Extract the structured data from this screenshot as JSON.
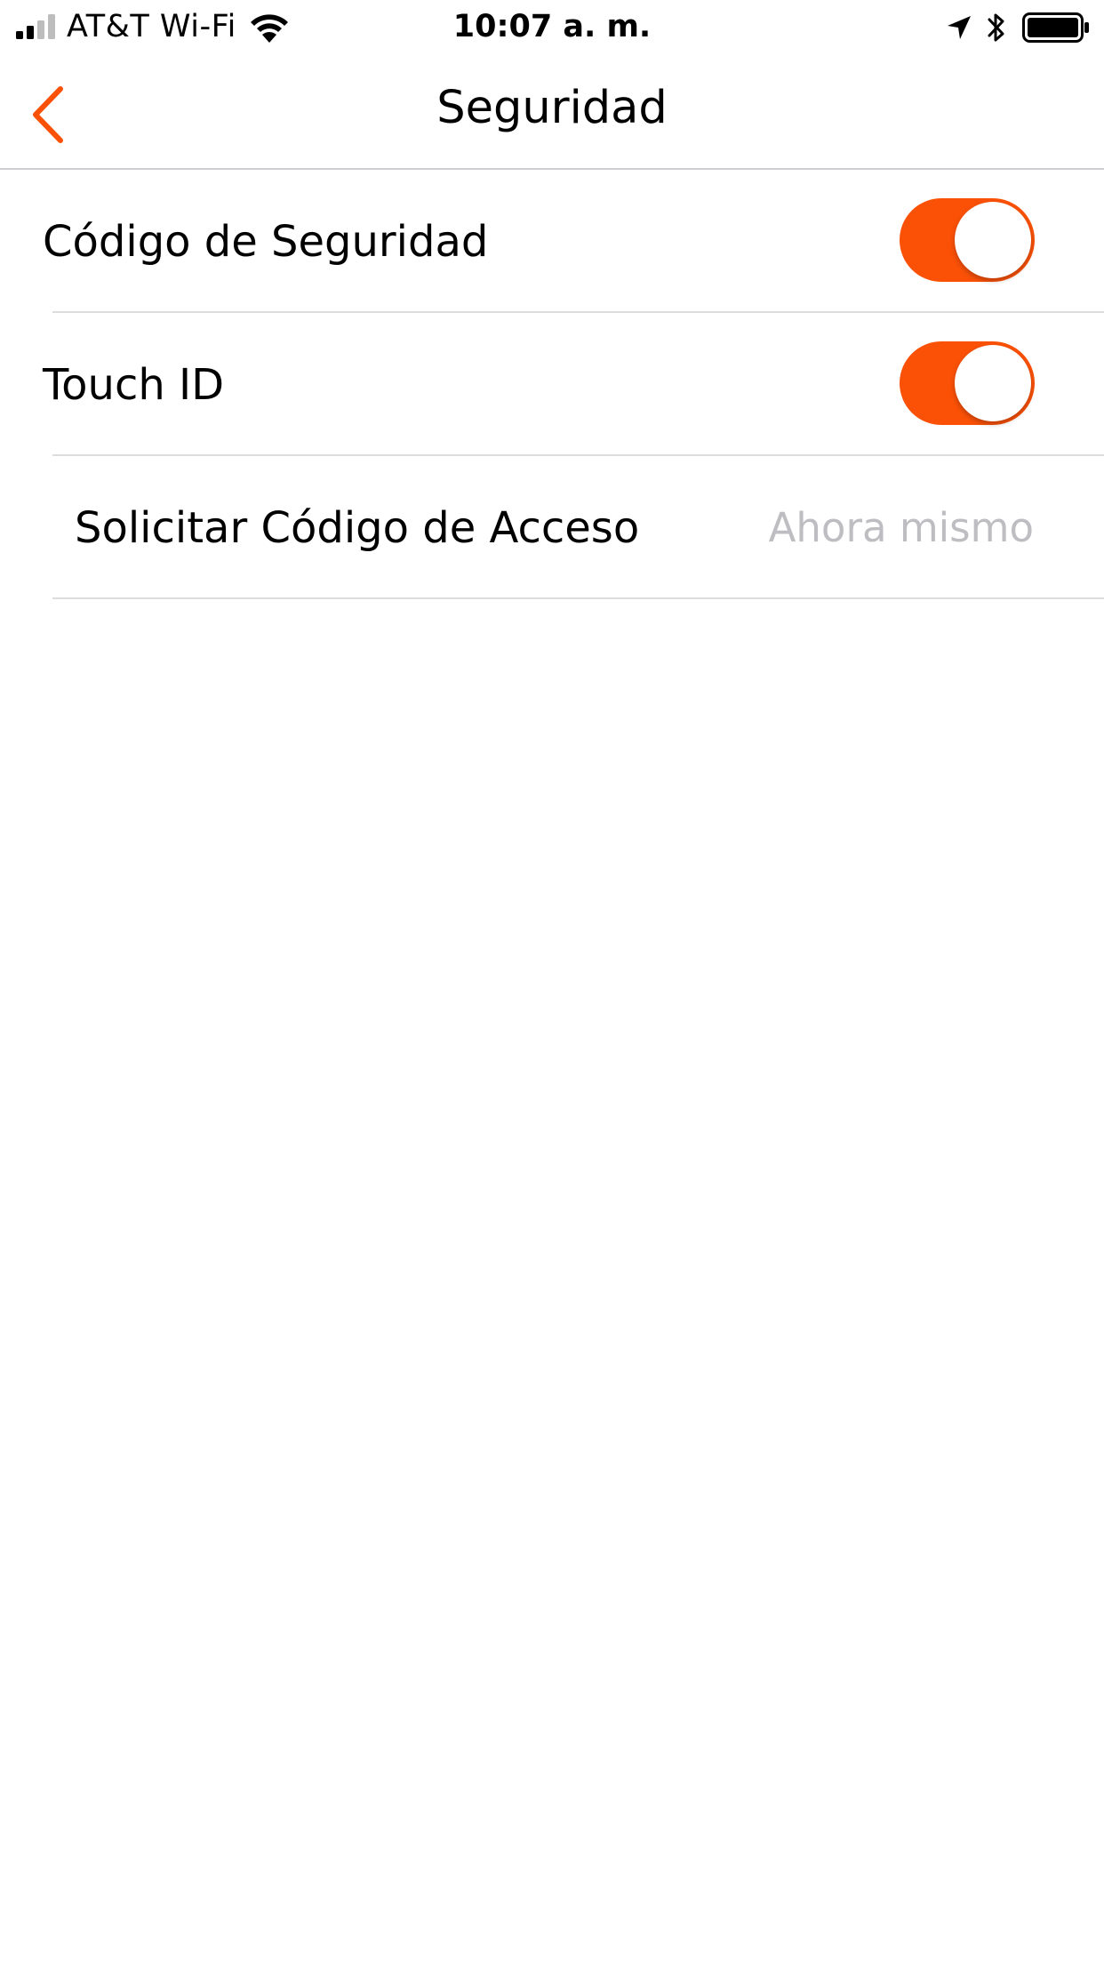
{
  "status_bar": {
    "carrier": "AT&T Wi-Fi",
    "time": "10:07 a. m.",
    "icons": [
      "signal-icon",
      "wifi-icon",
      "location-arrow-icon",
      "bluetooth-icon",
      "battery-icon"
    ]
  },
  "nav": {
    "title": "Seguridad",
    "back_icon": "chevron-left-icon"
  },
  "settings": {
    "items": [
      {
        "label": "Código de Seguridad",
        "type": "toggle",
        "on": true
      },
      {
        "label": "Touch ID",
        "type": "toggle",
        "on": true
      },
      {
        "label": "Solicitar Código de Acceso",
        "type": "value",
        "value": "Ahora mismo"
      }
    ]
  },
  "colors": {
    "accent": "#fa5107",
    "value_text": "#bdbdc2",
    "separator": "#dcdcdf"
  }
}
